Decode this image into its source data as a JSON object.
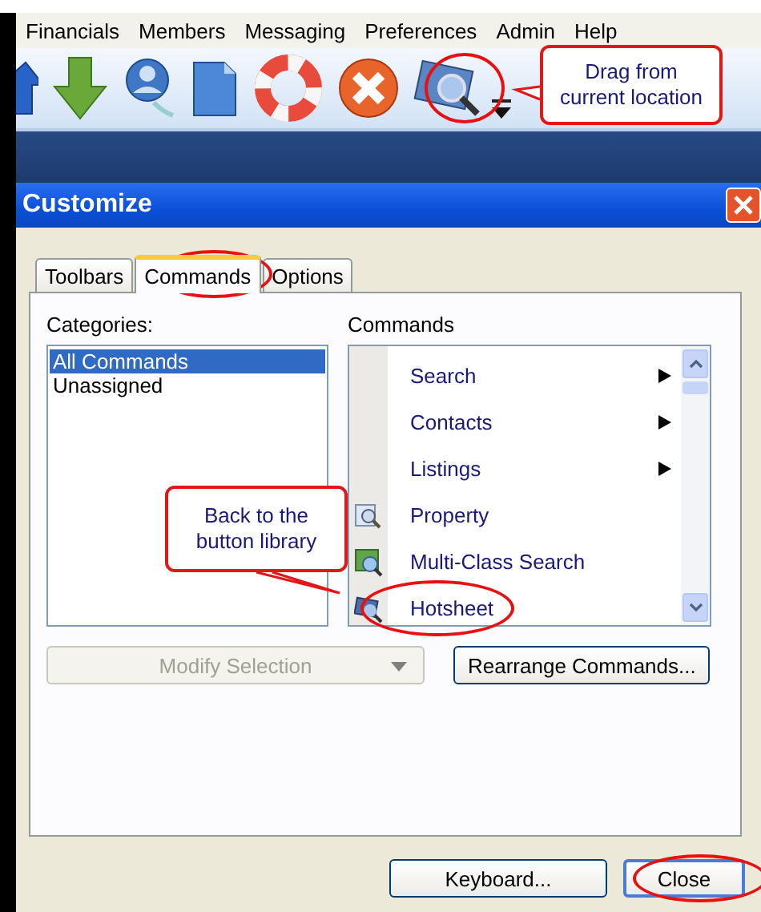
{
  "menu": [
    "Financials",
    "Members",
    "Messaging",
    "Preferences",
    "Admin",
    "Help"
  ],
  "callouts": [
    {
      "text": "Drag from current location"
    },
    {
      "text": "Back to the button library"
    }
  ],
  "toolbar": {
    "icons": [
      {
        "circled": false
      },
      {
        "circled": false
      },
      {
        "circled": false
      },
      {
        "circled": false
      },
      {
        "circled": false
      },
      {
        "circled": false
      },
      {
        "circled": true
      },
      {
        "circled": false
      }
    ]
  },
  "dialog": {
    "title": "Customize",
    "tabs": [
      {
        "label": "Toolbars",
        "selected": false,
        "circled": false
      },
      {
        "label": "Commands",
        "selected": true,
        "circled": true
      },
      {
        "label": "Options",
        "selected": false,
        "circled": false
      }
    ],
    "categories": {
      "label": "Categories:",
      "items": [
        {
          "label": "All Commands",
          "selected": true
        },
        {
          "label": "Unassigned",
          "selected": false
        }
      ]
    },
    "commands": {
      "label": "Commands",
      "items": [
        {
          "label": "Search",
          "kind": "submenu",
          "circled": false
        },
        {
          "label": "Contacts",
          "kind": "submenu",
          "circled": false
        },
        {
          "label": "Listings",
          "kind": "submenu",
          "circled": false
        },
        {
          "label": "Property",
          "kind": "command",
          "circled": false
        },
        {
          "label": "Multi-Class Search",
          "kind": "command",
          "circled": false
        },
        {
          "label": "Hotsheet",
          "kind": "command",
          "circled": true
        }
      ]
    },
    "modify": {
      "label": "Modify Selection",
      "disabled": true
    },
    "rearrange": "Rearrange Commands...",
    "buttons": [
      {
        "label": "Keyboard...",
        "circled": false
      },
      {
        "label": "Close",
        "circled": true
      }
    ]
  }
}
